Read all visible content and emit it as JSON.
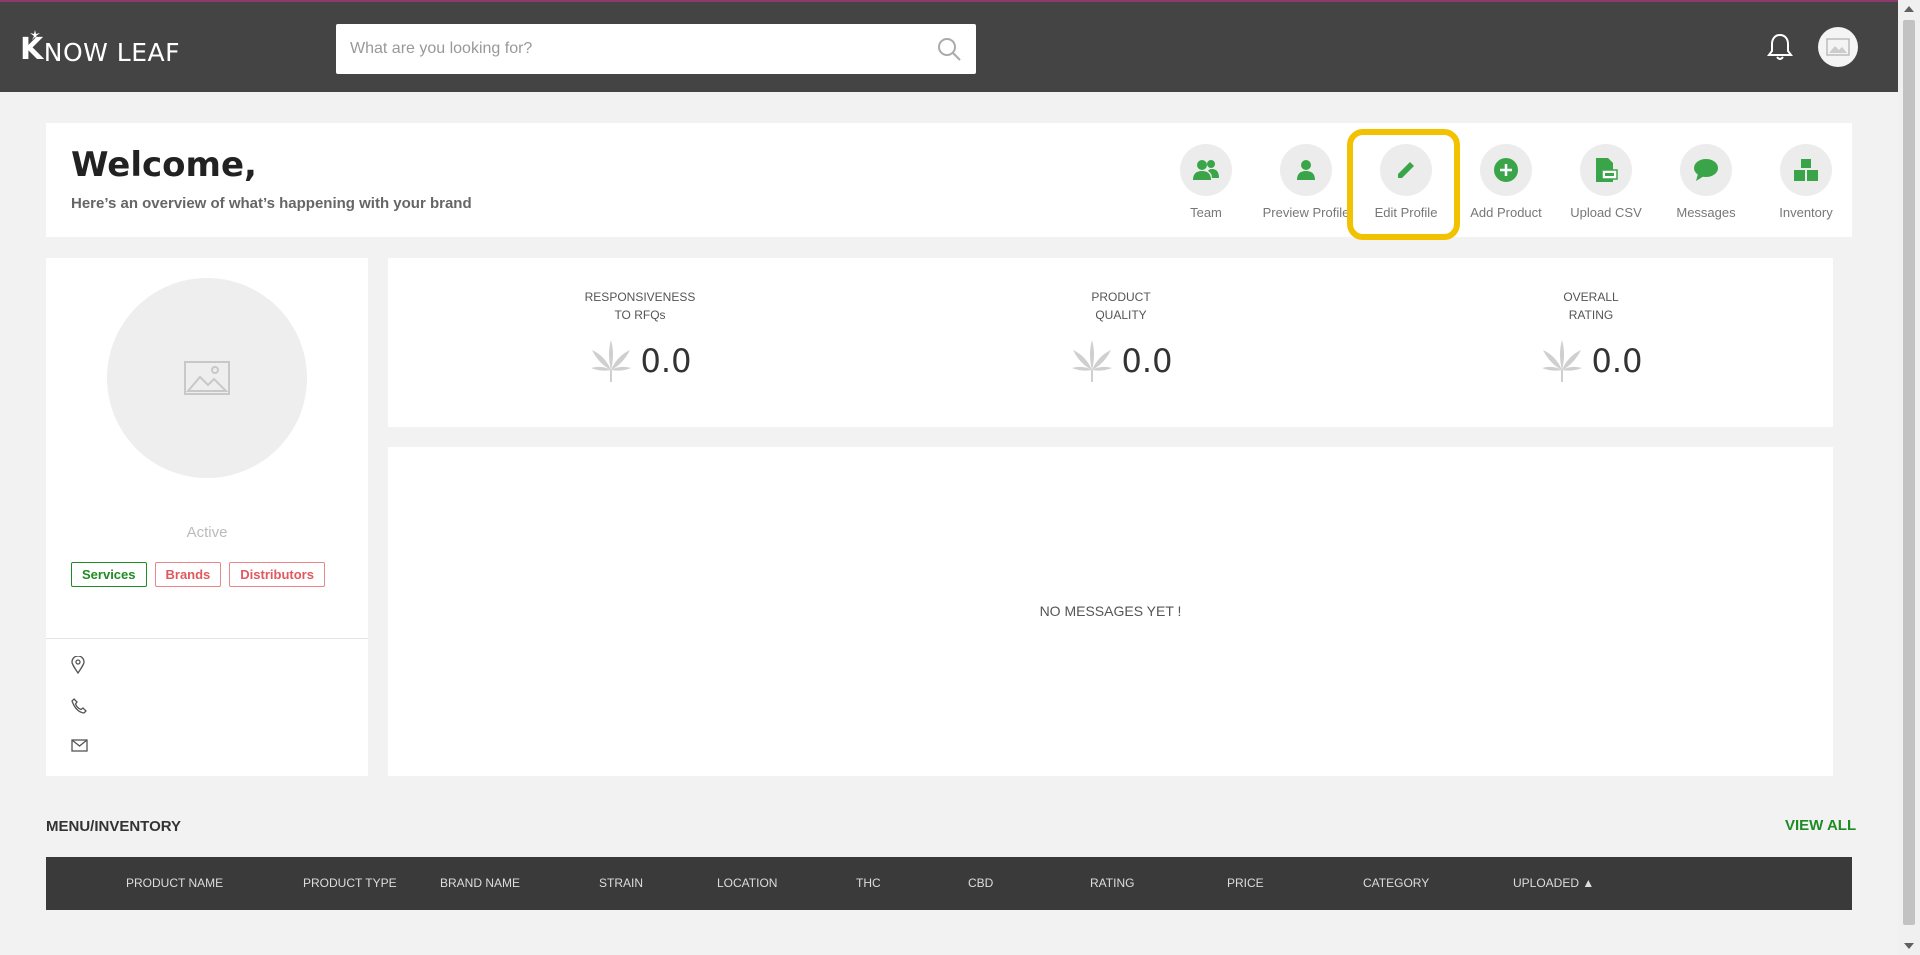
{
  "header": {
    "logo_text": "NOW LEAF",
    "logo_initial": "K",
    "search_placeholder": "What are you looking for?"
  },
  "welcome": {
    "title": "Welcome,",
    "subtitle": "Here’s an overview of what’s happening with your brand"
  },
  "actions": [
    {
      "label": "Team",
      "icon": "team-icon"
    },
    {
      "label": "Preview Profile",
      "icon": "person-icon"
    },
    {
      "label": "Edit Profile",
      "icon": "pencil-icon"
    },
    {
      "label": "Add Product",
      "icon": "plus-circle-icon"
    },
    {
      "label": "Upload CSV",
      "icon": "csv-file-icon"
    },
    {
      "label": "Messages",
      "icon": "chat-bubble-icon"
    },
    {
      "label": "Inventory",
      "icon": "boxes-icon"
    }
  ],
  "profile": {
    "status": "Active",
    "tags": [
      "Services",
      "Brands",
      "Distributors"
    ]
  },
  "ratings": [
    {
      "line1": "RESPONSIVENESS",
      "line2": "TO RFQs",
      "value": "0.0"
    },
    {
      "line1": "PRODUCT",
      "line2": "QUALITY",
      "value": "0.0"
    },
    {
      "line1": "OVERALL",
      "line2": "RATING",
      "value": "0.0"
    }
  ],
  "messages": {
    "empty_text": "NO MESSAGES YET !"
  },
  "inventory": {
    "title": "MENU/INVENTORY",
    "view_all": "VIEW ALL",
    "columns": [
      "PRODUCT NAME",
      "PRODUCT TYPE",
      "BRAND NAME",
      "STRAIN",
      "LOCATION",
      "THC",
      "CBD",
      "RATING",
      "PRICE",
      "CATEGORY",
      "UPLOADED"
    ],
    "sort_indicator": "▲"
  },
  "colors": {
    "topbar": "#444444",
    "accent_green": "#1f8b24",
    "icon_green": "#3aa548",
    "tag_red": "#e0595f",
    "highlight": "#f2c200"
  }
}
